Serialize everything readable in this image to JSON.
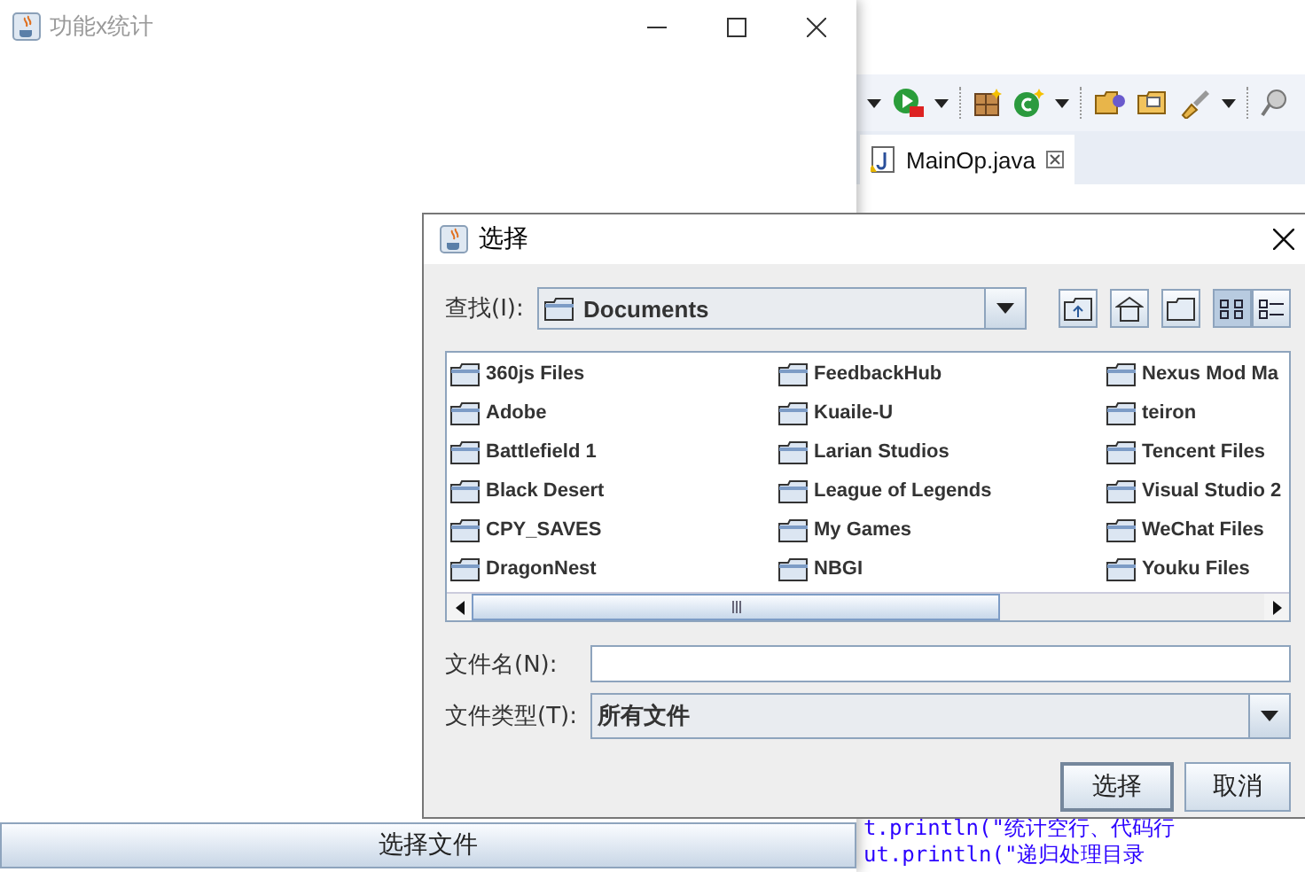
{
  "ide": {
    "tab": {
      "label": "MainOp.java",
      "selected": true
    },
    "code_lines": [
      "t.println(\"统计空行、代码行",
      "ut.println(\"递归处理目录"
    ]
  },
  "app_window": {
    "title": "功能x统计",
    "button": "选择文件"
  },
  "dialog": {
    "title": "选择",
    "look_in_label": "查找(I):",
    "look_in": "Documents",
    "views": [
      {
        "kind": "list",
        "selected": true
      },
      {
        "kind": "details",
        "selected": false
      }
    ],
    "files": [
      "360js Files",
      "Adobe",
      "Battlefield 1",
      "Black Desert",
      "CPY_SAVES",
      "DragonNest",
      "FeedbackHub",
      "Kuaile-U",
      "Larian Studios",
      "League of Legends",
      "My Games",
      "NBGI",
      "Nexus Mod Ma",
      "teiron",
      "Tencent Files",
      "Visual Studio 2",
      "WeChat Files",
      "Youku Files"
    ],
    "file_name_label": "文件名(N):",
    "file_type_label": "文件类型(T):",
    "file_type": "所有文件",
    "buttons": [
      {
        "label": "选择",
        "default": true
      },
      {
        "label": "取消",
        "default": false
      }
    ]
  }
}
